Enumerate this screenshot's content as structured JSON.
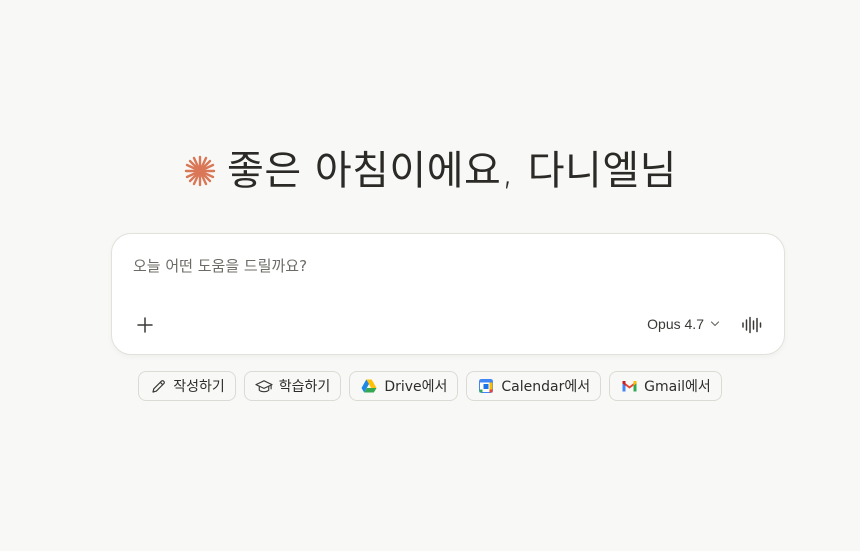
{
  "greeting": {
    "text": "좋은 아침이에요, 다니엘님"
  },
  "composer": {
    "placeholder": "오늘 어떤 도움을 드릴까요?",
    "model_label": "Opus 4.7"
  },
  "chips": [
    {
      "label": "작성하기",
      "icon": "pencil-icon"
    },
    {
      "label": "학습하기",
      "icon": "graduation-cap-icon"
    },
    {
      "label": "Drive에서",
      "icon": "google-drive-icon"
    },
    {
      "label": "Calendar에서",
      "icon": "google-calendar-icon"
    },
    {
      "label": "Gmail에서",
      "icon": "gmail-icon"
    }
  ],
  "colors": {
    "background": "#f8f8f6",
    "accent": "#d97757",
    "text": "#2b2a27"
  }
}
